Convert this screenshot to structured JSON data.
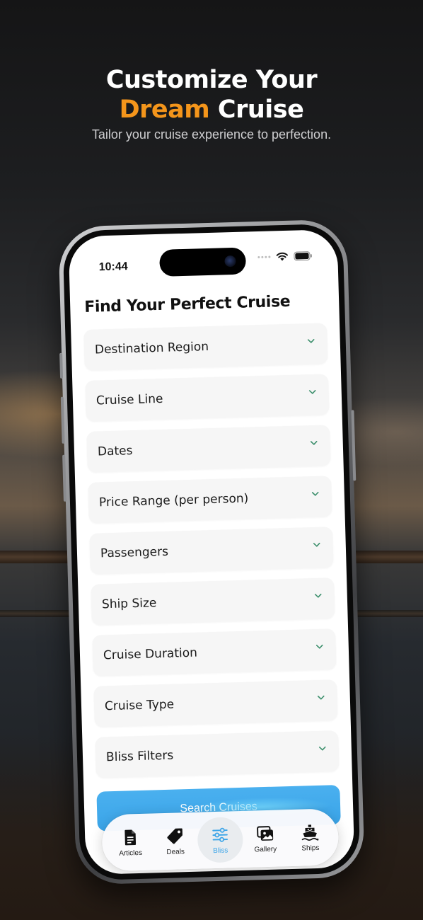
{
  "hero": {
    "title_line1": "Customize Your",
    "title_accent": "Dream",
    "title_rest": " Cruise",
    "subtitle": "Tailor your cruise experience to perfection."
  },
  "status_bar": {
    "time": "10:44"
  },
  "screen": {
    "title": "Find Your Perfect Cruise"
  },
  "filters": [
    {
      "label": "Destination Region"
    },
    {
      "label": "Cruise Line"
    },
    {
      "label": "Dates"
    },
    {
      "label": "Price Range (per person)"
    },
    {
      "label": "Passengers"
    },
    {
      "label": "Ship Size"
    },
    {
      "label": "Cruise Duration"
    },
    {
      "label": "Cruise Type"
    },
    {
      "label": "Bliss Filters"
    }
  ],
  "search_button": {
    "label": "Search Cruises"
  },
  "tabs": [
    {
      "label": "Articles",
      "icon": "document-icon",
      "active": false
    },
    {
      "label": "Deals",
      "icon": "tag-icon",
      "active": false
    },
    {
      "label": "Bliss",
      "icon": "sliders-icon",
      "active": true
    },
    {
      "label": "Gallery",
      "icon": "gallery-icon",
      "active": false
    },
    {
      "label": "Ships",
      "icon": "ship-icon",
      "active": false
    }
  ],
  "colors": {
    "accent": "#f4951b",
    "primary_blue": "#3aa4e8",
    "row_bg": "#f6f6f6"
  }
}
